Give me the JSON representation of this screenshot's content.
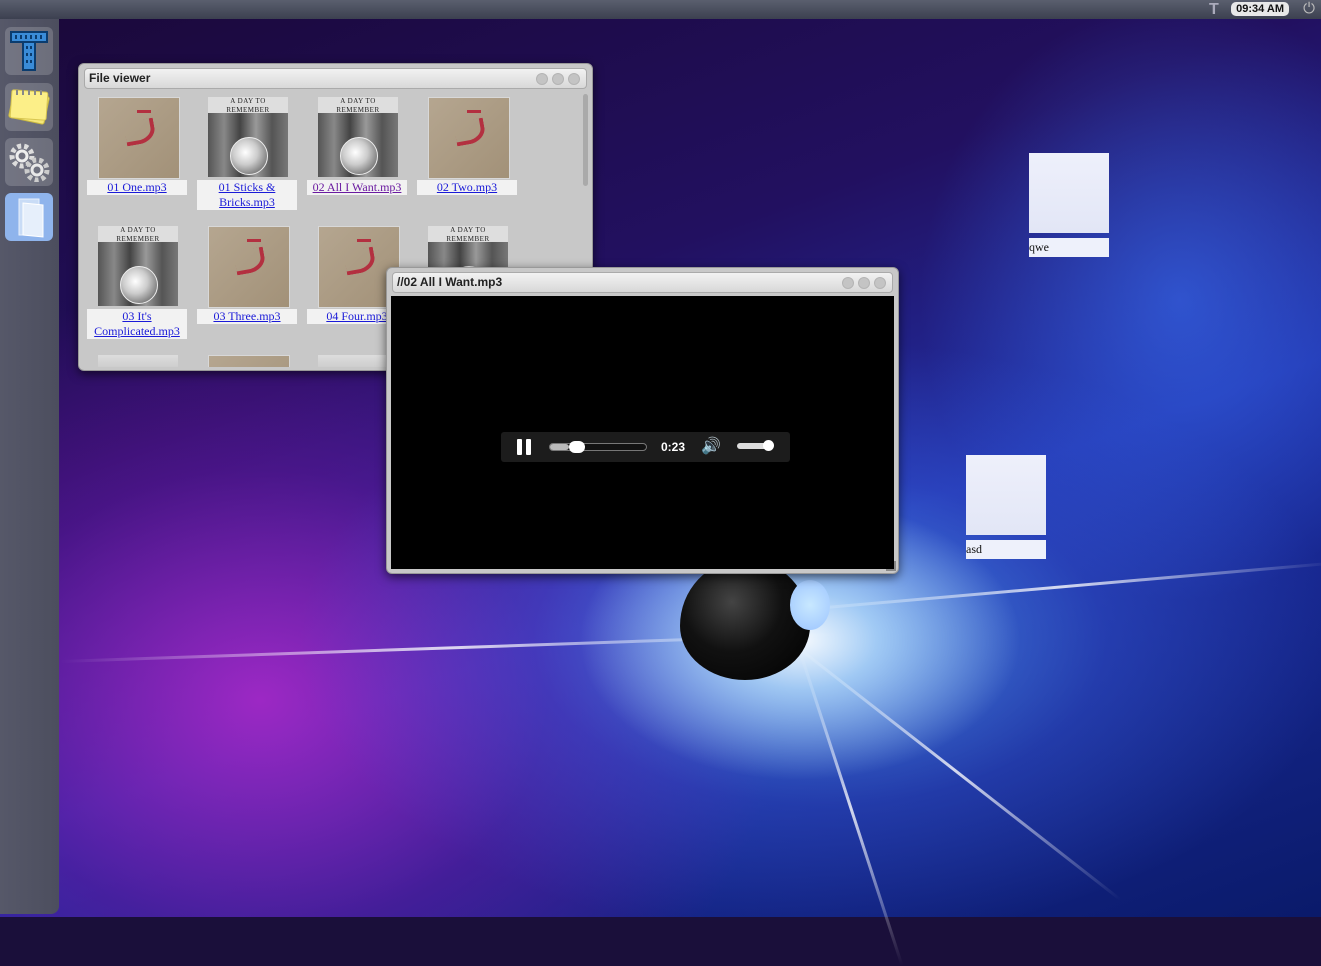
{
  "topbar": {
    "clock": "09:34 AM",
    "logo_icon": "T",
    "power_icon": "⏻"
  },
  "dock": {
    "items": [
      {
        "name": "t-logo-icon",
        "active": false
      },
      {
        "name": "notes-icon",
        "active": false
      },
      {
        "name": "settings-gears-icon",
        "active": false
      },
      {
        "name": "files-icon",
        "active": true
      }
    ]
  },
  "file_viewer": {
    "title": "File viewer",
    "files": [
      {
        "label": "01 One.mp3",
        "art": "craft",
        "visited": false
      },
      {
        "label": "01 Sticks & Bricks.mp3",
        "art": "adtr",
        "visited": false
      },
      {
        "label": "02 All I Want.mp3",
        "art": "adtr",
        "visited": true
      },
      {
        "label": "02 Two.mp3",
        "art": "craft",
        "visited": false
      },
      {
        "label": "03 It's Complicated.mp3",
        "art": "adtr",
        "visited": false
      },
      {
        "label": "03 Three.mp3",
        "art": "craft",
        "visited": false
      },
      {
        "label": "04 Four.mp3",
        "art": "craft",
        "visited": false
      },
      {
        "label": "",
        "art": "adtr",
        "visited": false
      }
    ],
    "album_header": "A DAY TO REMEMBER"
  },
  "player": {
    "title": "//02 All I Want.mp3",
    "time": "0:23",
    "progress": 0.2,
    "volume": 0.9
  },
  "desktop_icons": [
    {
      "label": "qwe"
    },
    {
      "label": "asd"
    }
  ]
}
